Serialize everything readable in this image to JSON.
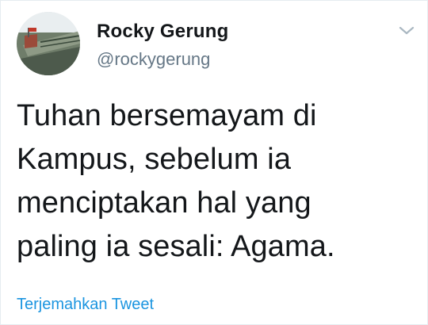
{
  "author": {
    "display_name": "Rocky Gerung",
    "handle": "@rockygerung"
  },
  "tweet": {
    "lines": [
      "Tuhan bersemayam di",
      "Kampus, sebelum ia",
      "menciptakan hal yang",
      "paling ia sesali: Agama."
    ]
  },
  "actions": {
    "translate_label": "Terjemahkan Tweet"
  },
  "icons": {
    "caret": "chevron-down-icon",
    "avatar": "avatar-image"
  },
  "colors": {
    "text": "#14171a",
    "secondary": "#657786",
    "link": "#1b95e0",
    "caret": "#aab8c2"
  }
}
